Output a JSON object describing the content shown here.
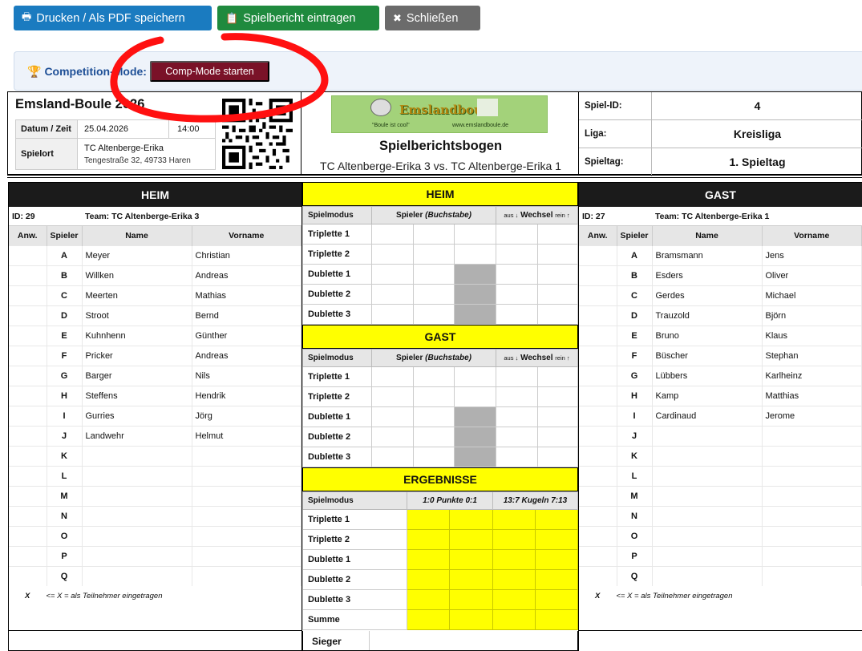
{
  "toolbar": {
    "print_label": "Drucken / Als PDF speichern",
    "report_label": "Spielbericht eintragen",
    "close_label": "Schließen",
    "print_color": "#1a7bc0",
    "report_color": "#1f8a3e",
    "close_color": "#6b6b6b"
  },
  "comp_mode": {
    "label": "Competition-Mode:",
    "button": "Comp-Mode starten"
  },
  "event": {
    "title": "Emsland-Boule 2026",
    "date_label": "Datum / Zeit",
    "date": "25.04.2026",
    "time": "14:00",
    "venue_label": "Spielort",
    "venue_name": "TC Altenberge-Erika",
    "venue_address": "Tengestraße 32, 49733 Haren"
  },
  "logo": {
    "title": "Emslandboule",
    "slogan": "\"Boule ist cool\"",
    "url": "www.emslandboule.de"
  },
  "sheet": {
    "title": "Spielberichtsbogen",
    "match": "TC Altenberge-Erika 3 vs. TC Altenberge-Erika 1"
  },
  "info": [
    {
      "key": "Spiel-ID:",
      "value": "4"
    },
    {
      "key": "Liga:",
      "value": "Kreisliga"
    },
    {
      "key": "Spieltag:",
      "value": "1. Spieltag"
    }
  ],
  "home": {
    "header": "HEIM",
    "id": "ID: 29",
    "team": "Team: TC Altenberge-Erika 3",
    "cols": [
      "Anw.",
      "Spieler",
      "Name",
      "Vorname"
    ],
    "players": [
      {
        "letter": "A",
        "name": "Meyer",
        "first": "Christian"
      },
      {
        "letter": "B",
        "name": "Willken",
        "first": "Andreas"
      },
      {
        "letter": "C",
        "name": "Meerten",
        "first": "Mathias"
      },
      {
        "letter": "D",
        "name": "Stroot",
        "first": "Bernd"
      },
      {
        "letter": "E",
        "name": "Kuhnhenn",
        "first": "Günther"
      },
      {
        "letter": "F",
        "name": "Pricker",
        "first": "Andreas"
      },
      {
        "letter": "G",
        "name": "Barger",
        "first": "Nils"
      },
      {
        "letter": "H",
        "name": "Steffens",
        "first": "Hendrik"
      },
      {
        "letter": "I",
        "name": "Gurries",
        "first": "Jörg"
      },
      {
        "letter": "J",
        "name": "Landwehr",
        "first": "Helmut"
      },
      {
        "letter": "K",
        "name": "",
        "first": ""
      },
      {
        "letter": "L",
        "name": "",
        "first": ""
      },
      {
        "letter": "M",
        "name": "",
        "first": ""
      },
      {
        "letter": "N",
        "name": "",
        "first": ""
      },
      {
        "letter": "O",
        "name": "",
        "first": ""
      },
      {
        "letter": "P",
        "name": "",
        "first": ""
      },
      {
        "letter": "Q",
        "name": "",
        "first": ""
      }
    ],
    "legend_x": "X",
    "legend_text": "<= X = als Teilnehmer eingetragen"
  },
  "guest": {
    "header": "GAST",
    "id": "ID: 27",
    "team": "Team: TC Altenberge-Erika 1",
    "cols": [
      "Anw.",
      "Spieler",
      "Name",
      "Vorname"
    ],
    "players": [
      {
        "letter": "A",
        "name": "Bramsmann",
        "first": "Jens"
      },
      {
        "letter": "B",
        "name": "Esders",
        "first": "Oliver"
      },
      {
        "letter": "C",
        "name": "Gerdes",
        "first": "Michael"
      },
      {
        "letter": "D",
        "name": "Trauzold",
        "first": "Björn"
      },
      {
        "letter": "E",
        "name": "Bruno",
        "first": "Klaus"
      },
      {
        "letter": "F",
        "name": "Büscher",
        "first": "Stephan"
      },
      {
        "letter": "G",
        "name": "Lübbers",
        "first": "Karlheinz"
      },
      {
        "letter": "H",
        "name": "Kamp",
        "first": "Matthias"
      },
      {
        "letter": "I",
        "name": "Cardinaud",
        "first": "Jerome"
      },
      {
        "letter": "J",
        "name": "",
        "first": ""
      },
      {
        "letter": "K",
        "name": "",
        "first": ""
      },
      {
        "letter": "L",
        "name": "",
        "first": ""
      },
      {
        "letter": "M",
        "name": "",
        "first": ""
      },
      {
        "letter": "N",
        "name": "",
        "first": ""
      },
      {
        "letter": "O",
        "name": "",
        "first": ""
      },
      {
        "letter": "P",
        "name": "",
        "first": ""
      },
      {
        "letter": "Q",
        "name": "",
        "first": ""
      }
    ],
    "legend_x": "X",
    "legend_text": "<= X = als Teilnehmer eingetragen"
  },
  "center": {
    "home_header": "HEIM",
    "guest_header": "GAST",
    "results_header": "ERGEBNISSE",
    "col_mode": "Spielmodus",
    "col_player": "Spieler",
    "col_player_sub": "(Buchstabe)",
    "col_out": "aus ↓",
    "col_change": "Wechsel",
    "col_in": "rein ↑",
    "col_points": "1:0 Punkte 0:1",
    "col_balls": "13:7 Kugeln 7:13",
    "modes": [
      "Triplette 1",
      "Triplette 2",
      "Dublette 1",
      "Dublette 2",
      "Dublette 3"
    ],
    "sum": "Summe",
    "winner": "Sieger"
  }
}
